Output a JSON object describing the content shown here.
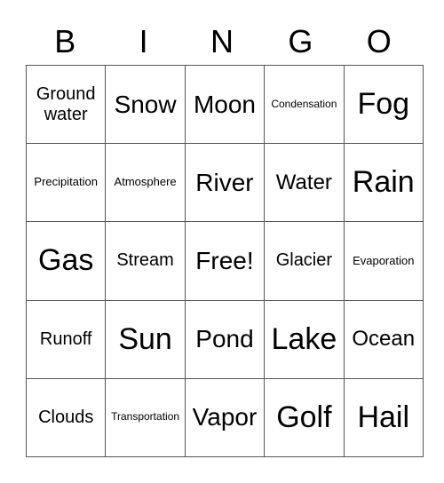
{
  "header": {
    "letters": [
      "B",
      "I",
      "N",
      "G",
      "O"
    ]
  },
  "grid": {
    "rows": [
      [
        "Ground water",
        "Snow",
        "Moon",
        "Condensation",
        "Fog"
      ],
      [
        "Precipitation",
        "Atmosphere",
        "River",
        "Water",
        "Rain"
      ],
      [
        "Gas",
        "Stream",
        "Free!",
        "Glacier",
        "Evaporation"
      ],
      [
        "Runoff",
        "Sun",
        "Pond",
        "Lake",
        "Ocean"
      ],
      [
        "Clouds",
        "Transportation",
        "Vapor",
        "Golf",
        "Hail"
      ]
    ]
  }
}
